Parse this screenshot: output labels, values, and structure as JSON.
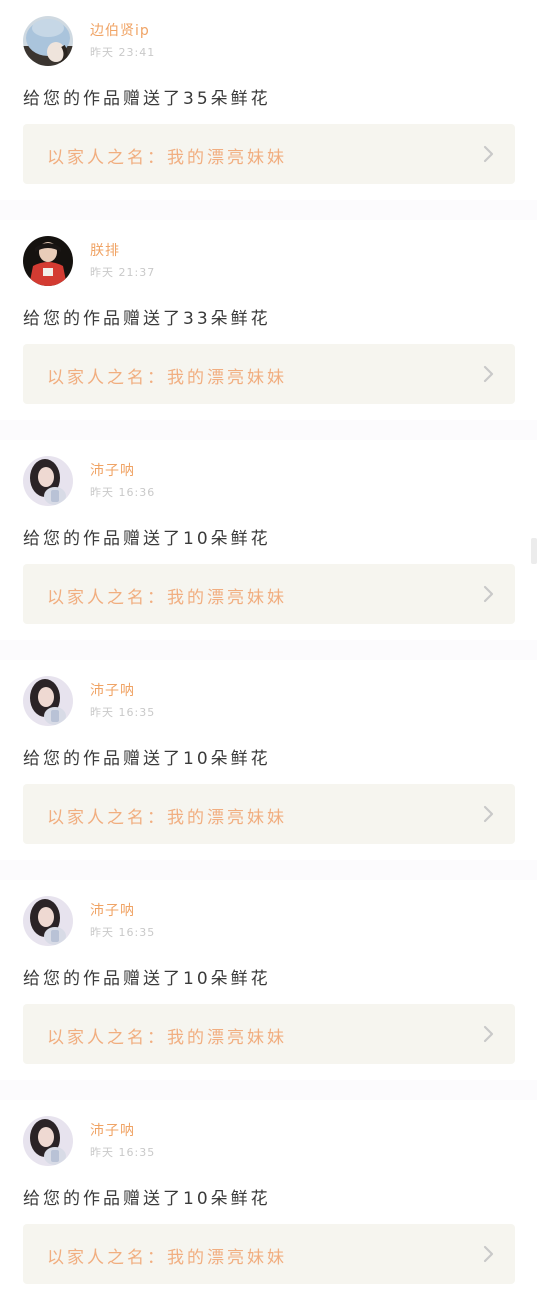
{
  "feed": {
    "items": [
      {
        "username": "边伯贤ip",
        "time": "昨天 23:41",
        "message": "给您的作品赠送了35朵鲜花",
        "gift_label": "以家人之名：我的漂亮妹妹",
        "avatar": "avatar-light-blue-hat-icon"
      },
      {
        "username": "朕排",
        "time": "昨天 21:37",
        "message": "给您的作品赠送了33朵鲜花",
        "gift_label": "以家人之名：我的漂亮妹妹",
        "avatar": "avatar-red-shirt-icon"
      },
      {
        "username": "沛子呐",
        "time": "昨天 16:36",
        "message": "给您的作品赠送了10朵鲜花",
        "gift_label": "以家人之名：我的漂亮妹妹",
        "avatar": "avatar-girl-dark-hair-icon"
      },
      {
        "username": "沛子呐",
        "time": "昨天 16:35",
        "message": "给您的作品赠送了10朵鲜花",
        "gift_label": "以家人之名：我的漂亮妹妹",
        "avatar": "avatar-girl-dark-hair-icon"
      },
      {
        "username": "沛子呐",
        "time": "昨天 16:35",
        "message": "给您的作品赠送了10朵鲜花",
        "gift_label": "以家人之名：我的漂亮妹妹",
        "avatar": "avatar-girl-dark-hair-icon"
      },
      {
        "username": "沛子呐",
        "time": "昨天 16:35",
        "message": "给您的作品赠送了10朵鲜花",
        "gift_label": "以家人之名：我的漂亮妹妹",
        "avatar": "avatar-girl-dark-hair-icon"
      }
    ]
  },
  "colors": {
    "username": "#f0a466",
    "gift_label": "#f1ae80",
    "gift_background": "#f6f5ef",
    "separator": "#fcfbfd",
    "message_text": "#3a3a3a",
    "time_text": "#c9c9c9"
  }
}
